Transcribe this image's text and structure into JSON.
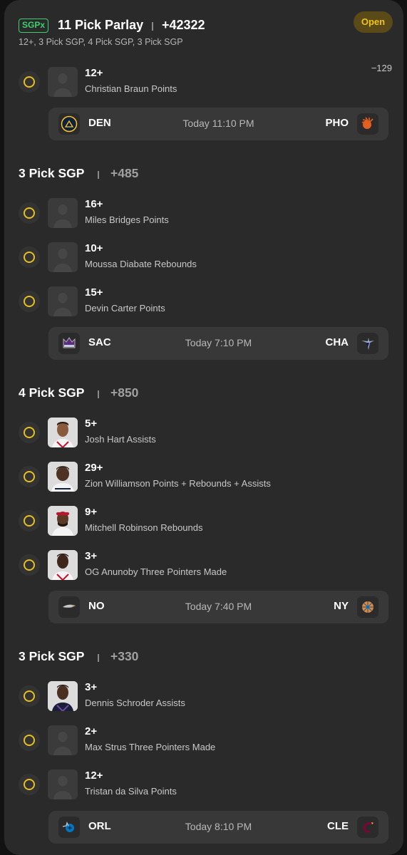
{
  "parlay": {
    "badge": "SGPx",
    "title": "11 Pick Parlay",
    "odds": "+42322",
    "subtitle": "12+, 3 Pick SGP, 4 Pick SGP, 3 Pick SGP",
    "status": "Open"
  },
  "leg1": {
    "picks": [
      {
        "line": "12+",
        "name": "Christian Braun Points",
        "odds": "−129",
        "avatar": "silhouette"
      }
    ],
    "game": {
      "home": "DEN",
      "home_icon": "nuggets-logo-icon",
      "time": "Today 11:10 PM",
      "away": "PHO",
      "away_icon": "suns-logo-icon"
    }
  },
  "sgp1": {
    "title": "3 Pick SGP",
    "odds": "+485",
    "picks": [
      {
        "line": "16+",
        "name": "Miles Bridges Points",
        "avatar": "silhouette"
      },
      {
        "line": "10+",
        "name": "Moussa Diabate Rebounds",
        "avatar": "silhouette"
      },
      {
        "line": "15+",
        "name": "Devin Carter Points",
        "avatar": "silhouette"
      }
    ],
    "game": {
      "home": "SAC",
      "home_icon": "kings-logo-icon",
      "time": "Today 7:10 PM",
      "away": "CHA",
      "away_icon": "hornets-logo-icon"
    }
  },
  "sgp2": {
    "title": "4 Pick SGP",
    "odds": "+850",
    "picks": [
      {
        "line": "5+",
        "name": "Josh Hart Assists",
        "avatar": "photo"
      },
      {
        "line": "29+",
        "name": "Zion Williamson Points + Rebounds + Assists",
        "avatar": "photo"
      },
      {
        "line": "9+",
        "name": "Mitchell Robinson Rebounds",
        "avatar": "photo"
      },
      {
        "line": "3+",
        "name": "OG Anunoby Three Pointers Made",
        "avatar": "photo"
      }
    ],
    "game": {
      "home": "NO",
      "home_icon": "pelicans-logo-icon",
      "time": "Today 7:40 PM",
      "away": "NY",
      "away_icon": "knicks-logo-icon"
    }
  },
  "sgp3": {
    "title": "3 Pick SGP",
    "odds": "+330",
    "picks": [
      {
        "line": "3+",
        "name": "Dennis Schroder Assists",
        "avatar": "photo"
      },
      {
        "line": "2+",
        "name": "Max Strus Three Pointers Made",
        "avatar": "silhouette"
      },
      {
        "line": "12+",
        "name": "Tristan da Silva Points",
        "avatar": "silhouette"
      }
    ],
    "game": {
      "home": "ORL",
      "home_icon": "magic-logo-icon",
      "time": "Today 8:10 PM",
      "away": "CLE",
      "away_icon": "cavaliers-logo-icon"
    }
  },
  "colors": {
    "accent_green": "#3bd16f",
    "open_text": "#f0c419",
    "radio_ring": "#e8bf1b",
    "card_bg": "#2a2a2a"
  }
}
